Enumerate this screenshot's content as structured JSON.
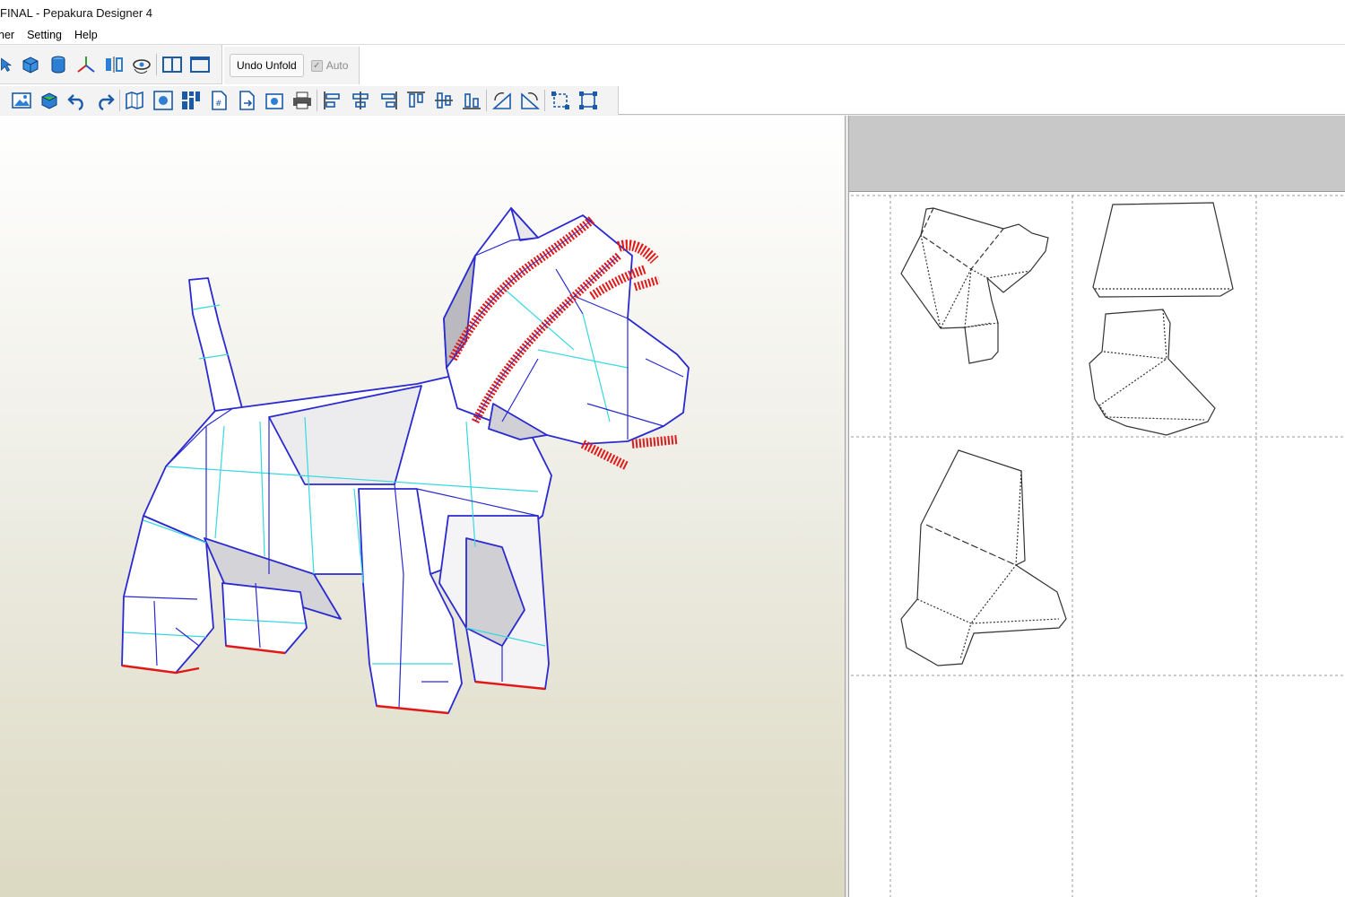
{
  "window": {
    "title": "FINAL - Pepakura Designer 4"
  },
  "menu": {
    "items": [
      "ner",
      "Setting",
      "Help"
    ]
  },
  "toolbar": {
    "undo_unfold_label": "Undo Unfold",
    "auto_label": "Auto",
    "auto_checked": true,
    "row1_icons": [
      "select-icon",
      "box-icon",
      "cylinder-icon",
      "axis-icon",
      "mirror-icon",
      "eye-rotate-icon",
      "split-view-icon",
      "single-view-icon"
    ],
    "row2_icons": [
      "texture-icon",
      "cube-color-icon",
      "undo-icon",
      "redo-icon",
      "unfold-icon",
      "zoom-fit-icon",
      "arrange-icon",
      "page-number-icon",
      "export-icon",
      "print-preview-icon",
      "print-icon",
      "align-left-icon",
      "align-center-icon",
      "align-right-icon",
      "align-top-icon",
      "align-middle-icon",
      "align-bottom-icon",
      "rotate-left-icon",
      "rotate-right-icon",
      "group-icon",
      "ungroup-icon"
    ]
  },
  "colors": {
    "mesh_edge": "#2a2ad0",
    "fold_edge": "#38d8e0",
    "cut_edge": "#e01818",
    "face": "#ffffff",
    "shadow_face": "#c9c9cd"
  }
}
